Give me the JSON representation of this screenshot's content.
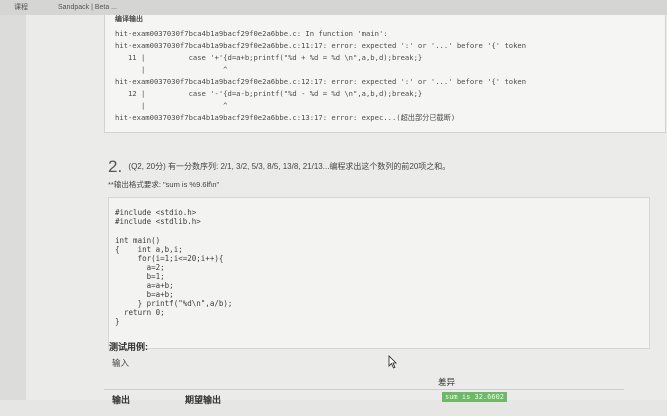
{
  "browser": {
    "tabs": [
      "课程",
      "Sandpack | Beta ..."
    ]
  },
  "compile_errors": {
    "heading": "编译输出",
    "lines": [
      "hit-exam0037030f7bca4b1a9bacf29f0e2a6bbe.c: In function 'main':",
      "hit-exam0037030f7bca4b1a9bacf29f0e2a6bbe.c:11:17: error: expected ':' or '...' before '{' token",
      "   11 |          case '+'{d=a+b;printf(\"%d + %d = %d \\n\",a,b,d);break;}",
      "      |                  ^",
      "hit-exam0037030f7bca4b1a9bacf29f0e2a6bbe.c:12:17: error: expected ':' or '...' before '{' token",
      "   12 |          case '-'{d=a-b;printf(\"%d - %d = %d \\n\",a,b,d);break;}",
      "      |                  ^",
      "hit-exam0037030f7bca4b1a9bacf29f0e2a6bbe.c:13:17: error: expec...(超出部分已截断)"
    ]
  },
  "question": {
    "number": "2.",
    "meta": "(Q2, 20分)",
    "text": "有一分数序列: 2/1, 3/2, 5/3, 8/5, 13/8, 21/13...编程求出这个数列的前20项之和。",
    "format": "**输出格式要求: \"sum is %9.6lf\\n\""
  },
  "code_lines": [
    "#include <stdio.h>",
    "#include <stdlib.h>",
    "",
    "int main()",
    "{    int a,b,i;",
    "     for(i=1;i<=20;i++){",
    "       a=2;",
    "       b=1;",
    "       a=a+b;",
    "       b=a+b;",
    "     } printf(\"%d\\n\",a/b);",
    "  return 0;",
    "}"
  ],
  "test_cases": {
    "label": "测试用例:",
    "input_label": "输入",
    "columns": [
      "输出",
      "期望输出",
      "差异"
    ],
    "diff_value": "sum is 32.6602"
  },
  "colors": {
    "page_bg": "#ebebea",
    "diff_chip": "#6fb86a"
  }
}
